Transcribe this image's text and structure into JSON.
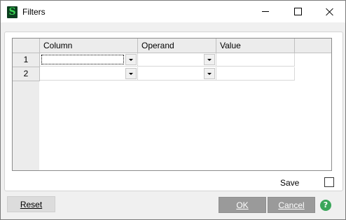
{
  "window": {
    "title": "Filters",
    "icon": "S",
    "icon_name": "sage-app-icon"
  },
  "grid": {
    "columns": [
      "Column",
      "Operand",
      "Value"
    ],
    "rows": [
      {
        "num": "1",
        "column": "",
        "operand": "",
        "value": ""
      },
      {
        "num": "2",
        "column": "",
        "operand": "",
        "value": ""
      }
    ]
  },
  "save": {
    "label": "Save",
    "checked": false
  },
  "buttons": {
    "reset": "Reset",
    "ok": "OK",
    "cancel": "Cancel",
    "help": "?"
  },
  "colors": {
    "accent_icon": "#39d353",
    "button_disabled_bg": "#9a9a9a",
    "help_green": "#3aa65a"
  }
}
